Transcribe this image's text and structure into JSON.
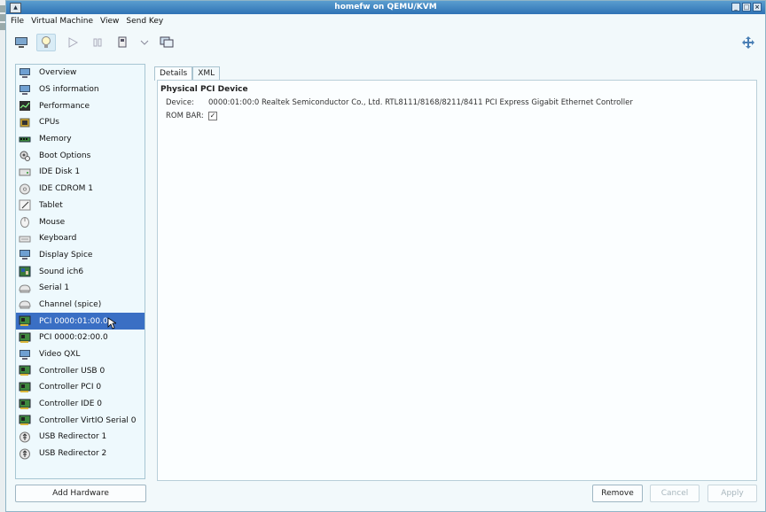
{
  "window": {
    "title": "homefw on QEMU/KVM"
  },
  "menu": [
    "File",
    "Virtual Machine",
    "View",
    "Send Key"
  ],
  "toolbar": [
    {
      "name": "console-icon"
    },
    {
      "name": "details-lightbulb-icon"
    },
    {
      "name": "run-icon"
    },
    {
      "name": "pause-icon"
    },
    {
      "name": "shutdown-icon"
    },
    {
      "name": "chevron-down-icon"
    },
    {
      "name": "snapshot-icon"
    },
    {
      "name": "fullscreen-icon"
    }
  ],
  "hardware": [
    {
      "label": "Overview",
      "icon": "monitor-icon"
    },
    {
      "label": "OS information",
      "icon": "monitor-icon"
    },
    {
      "label": "Performance",
      "icon": "chart-icon"
    },
    {
      "label": "CPUs",
      "icon": "cpu-icon"
    },
    {
      "label": "Memory",
      "icon": "memory-icon"
    },
    {
      "label": "Boot Options",
      "icon": "gear-icon"
    },
    {
      "label": "IDE Disk 1",
      "icon": "disk-icon"
    },
    {
      "label": "IDE CDROM 1",
      "icon": "cdrom-icon"
    },
    {
      "label": "Tablet",
      "icon": "tablet-icon"
    },
    {
      "label": "Mouse",
      "icon": "mouse-icon"
    },
    {
      "label": "Keyboard",
      "icon": "keyboard-icon"
    },
    {
      "label": "Display Spice",
      "icon": "monitor-icon"
    },
    {
      "label": "Sound ich6",
      "icon": "sound-icon"
    },
    {
      "label": "Serial 1",
      "icon": "serial-icon"
    },
    {
      "label": "Channel (spice)",
      "icon": "serial-icon"
    },
    {
      "label": "PCI 0000:01:00.0",
      "icon": "pci-card-icon",
      "selected": true
    },
    {
      "label": "PCI 0000:02:00.0",
      "icon": "pci-card-icon"
    },
    {
      "label": "Video QXL",
      "icon": "monitor-icon"
    },
    {
      "label": "Controller USB 0",
      "icon": "pci-card-icon"
    },
    {
      "label": "Controller PCI 0",
      "icon": "pci-card-icon"
    },
    {
      "label": "Controller IDE 0",
      "icon": "pci-card-icon"
    },
    {
      "label": "Controller VirtIO Serial 0",
      "icon": "pci-card-icon"
    },
    {
      "label": "USB Redirector 1",
      "icon": "usb-icon"
    },
    {
      "label": "USB Redirector 2",
      "icon": "usb-icon"
    }
  ],
  "add_hardware_label": "Add Hardware",
  "tabs": [
    "Details",
    "XML"
  ],
  "details": {
    "section_title": "Physical PCI Device",
    "device_label": "Device:",
    "device_value": "0000:01:00:0 Realtek Semiconductor Co., Ltd. RTL8111/8168/8211/8411 PCI Express Gigabit Ethernet Controller",
    "rombar_label": "ROM BAR:",
    "rombar_checked": true
  },
  "buttons": {
    "remove": "Remove",
    "cancel": "Cancel",
    "apply": "Apply"
  }
}
